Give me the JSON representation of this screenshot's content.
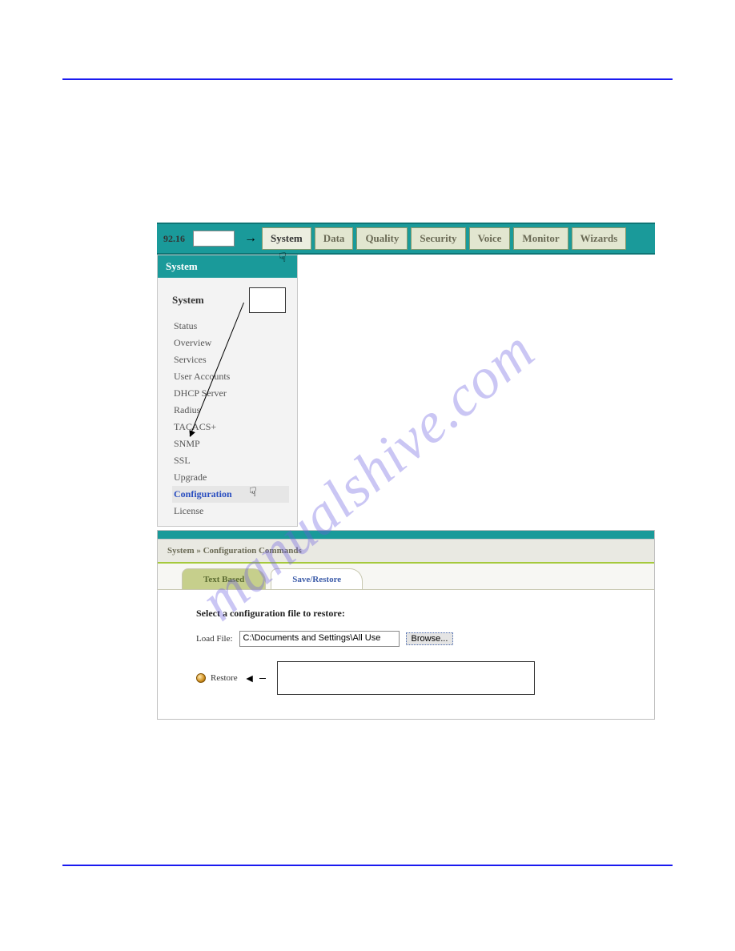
{
  "watermark": "manualshive.com",
  "menubar": {
    "ip_fragment": "92.16",
    "tabs": [
      "System",
      "Data",
      "Quality",
      "Security",
      "Voice",
      "Monitor",
      "Wizards"
    ],
    "active_index": 0
  },
  "sidebar": {
    "header": "System",
    "title": "System",
    "items": [
      {
        "label": "Status",
        "highlight": false
      },
      {
        "label": "Overview",
        "highlight": false
      },
      {
        "label": "Services",
        "highlight": false
      },
      {
        "label": "User Accounts",
        "highlight": false
      },
      {
        "label": "DHCP Server",
        "highlight": false
      },
      {
        "label": "Radius",
        "highlight": false
      },
      {
        "label": "TACACS+",
        "highlight": false
      },
      {
        "label": "SNMP",
        "highlight": false
      },
      {
        "label": "SSL",
        "highlight": false
      },
      {
        "label": "Upgrade",
        "highlight": false
      },
      {
        "label": "Configuration",
        "highlight": true
      },
      {
        "label": "License",
        "highlight": false
      }
    ]
  },
  "config_panel": {
    "breadcrumb": "System » Configuration Commands",
    "tabs": {
      "inactive": "Text Based",
      "active": "Save/Restore"
    },
    "heading": "Select a configuration file to restore:",
    "load_label": "Load File:",
    "load_value": "C:\\Documents and Settings\\All Use",
    "browse_label": "Browse...",
    "restore_label": "Restore"
  }
}
